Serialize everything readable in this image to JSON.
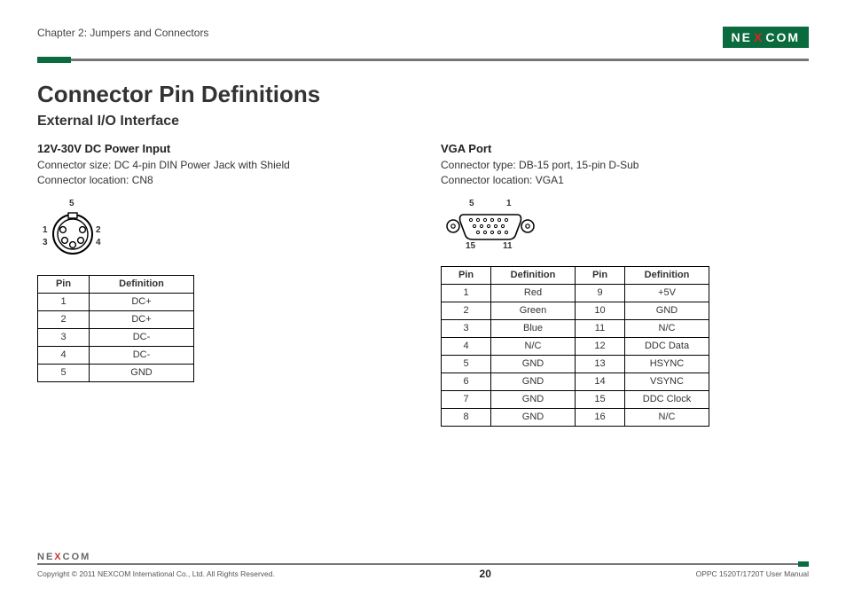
{
  "header": {
    "chapter": "Chapter 2: Jumpers and Connectors",
    "logo_pre": "NE",
    "logo_x": "X",
    "logo_post": "COM"
  },
  "title": "Connector Pin Definitions",
  "subtitle": "External I/O Interface",
  "left": {
    "heading": "12V-30V DC Power Input",
    "line1": "Connector size: DC 4-pin DIN Power Jack with Shield",
    "line2": "Connector location: CN8",
    "labels": {
      "top": "5",
      "l1": "1",
      "l2": "3",
      "r1": "2",
      "r2": "4"
    },
    "cols": [
      "Pin",
      "Definition"
    ],
    "rows": [
      [
        "1",
        "DC+"
      ],
      [
        "2",
        "DC+"
      ],
      [
        "3",
        "DC-"
      ],
      [
        "4",
        "DC-"
      ],
      [
        "5",
        "GND"
      ]
    ]
  },
  "right": {
    "heading": "VGA Port",
    "line1": "Connector type: DB-15 port, 15-pin D-Sub",
    "line2": "Connector location: VGA1",
    "labels": {
      "tl": "5",
      "tr": "1",
      "bl": "15",
      "br": "11"
    },
    "cols": [
      "Pin",
      "Definition",
      "Pin",
      "Definition"
    ],
    "rows": [
      [
        "1",
        "Red",
        "9",
        "+5V"
      ],
      [
        "2",
        "Green",
        "10",
        "GND"
      ],
      [
        "3",
        "Blue",
        "11",
        "N/C"
      ],
      [
        "4",
        "N/C",
        "12",
        "DDC Data"
      ],
      [
        "5",
        "GND",
        "13",
        "HSYNC"
      ],
      [
        "6",
        "GND",
        "14",
        "VSYNC"
      ],
      [
        "7",
        "GND",
        "15",
        "DDC Clock"
      ],
      [
        "8",
        "GND",
        "16",
        "N/C"
      ]
    ]
  },
  "footer": {
    "logo_pre": "NE",
    "logo_x": "X",
    "logo_post": "COM",
    "copyright": "Copyright © 2011 NEXCOM International Co., Ltd. All Rights Reserved.",
    "page": "20",
    "doc": "OPPC 1520T/1720T User Manual"
  }
}
